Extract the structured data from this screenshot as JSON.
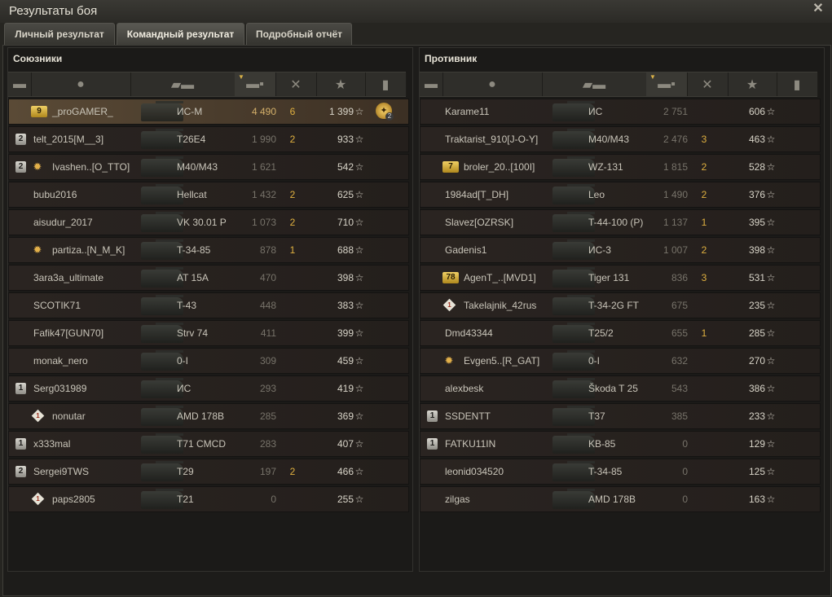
{
  "window": {
    "title": "Результаты боя"
  },
  "tabs": [
    {
      "label": "Личный результат"
    },
    {
      "label": "Командный результат"
    },
    {
      "label": "Подробный отчёт"
    }
  ],
  "star_glyph": "★",
  "allies": {
    "title": "Союзники",
    "rows": [
      {
        "badge": "",
        "mark": {
          "type": "num",
          "text": "9"
        },
        "name": "_proGAMER_",
        "tank": "ИС-М",
        "damage": "4 490",
        "kills": "6",
        "xp": "1 399",
        "player": true,
        "medal": "2"
      },
      {
        "badge": "2",
        "mark": null,
        "name": "telt_2015[M__3]",
        "tank": "T26E4",
        "damage": "1 990",
        "kills": "2",
        "xp": "933"
      },
      {
        "badge": "2",
        "mark": {
          "type": "sun",
          "text": ""
        },
        "name": "Ivashen..[O_TTO]",
        "tank": "M40/M43",
        "damage": "1 621",
        "kills": "",
        "xp": "542"
      },
      {
        "badge": "",
        "mark": null,
        "name": "bubu2016",
        "tank": "Hellcat",
        "damage": "1 432",
        "kills": "2",
        "xp": "625"
      },
      {
        "badge": "",
        "mark": null,
        "name": "aisudur_2017",
        "tank": "VK 30.01 P",
        "damage": "1 073",
        "kills": "2",
        "xp": "710"
      },
      {
        "badge": "",
        "mark": {
          "type": "sun",
          "text": ""
        },
        "name": "partiza..[N_M_K]",
        "tank": "T-34-85",
        "damage": "878",
        "kills": "1",
        "xp": "688"
      },
      {
        "badge": "",
        "mark": null,
        "name": "3ara3a_ultimate",
        "tank": "AT 15A",
        "damage": "470",
        "kills": "",
        "xp": "398"
      },
      {
        "badge": "",
        "mark": null,
        "name": "SCOTIK71",
        "tank": "T-43",
        "damage": "448",
        "kills": "",
        "xp": "383"
      },
      {
        "badge": "",
        "mark": null,
        "name": "Fafik47[GUN70]",
        "tank": "Strv 74",
        "damage": "411",
        "kills": "",
        "xp": "399"
      },
      {
        "badge": "",
        "mark": null,
        "name": "monak_nero",
        "tank": "0-I",
        "damage": "309",
        "kills": "",
        "xp": "459"
      },
      {
        "badge": "1",
        "mark": null,
        "name": "Serg031989",
        "tank": "ИС",
        "damage": "293",
        "kills": "",
        "xp": "419"
      },
      {
        "badge": "",
        "mark": {
          "type": "diamond",
          "text": "1"
        },
        "name": "nonutar",
        "tank": "AMD 178B",
        "damage": "285",
        "kills": "",
        "xp": "369"
      },
      {
        "badge": "1",
        "mark": null,
        "name": "x333mal",
        "tank": "T71 CMCD",
        "damage": "283",
        "kills": "",
        "xp": "407"
      },
      {
        "badge": "2",
        "mark": null,
        "name": "Sergei9TWS",
        "tank": "T29",
        "damage": "197",
        "kills": "2",
        "xp": "466"
      },
      {
        "badge": "",
        "mark": {
          "type": "diamond",
          "text": "1"
        },
        "name": "paps2805",
        "tank": "T21",
        "damage": "0",
        "kills": "",
        "xp": "255"
      }
    ]
  },
  "enemies": {
    "title": "Противник",
    "rows": [
      {
        "badge": "",
        "mark": null,
        "name": "Karame11",
        "tank": "ИС",
        "damage": "2 751",
        "kills": "",
        "xp": "606"
      },
      {
        "badge": "",
        "mark": null,
        "name": "Traktarist_910[J-O-Y]",
        "tank": "M40/M43",
        "damage": "2 476",
        "kills": "3",
        "xp": "463"
      },
      {
        "badge": "",
        "mark": {
          "type": "num",
          "text": "7"
        },
        "name": "broler_20..[100I]",
        "tank": "WZ-131",
        "damage": "1 815",
        "kills": "2",
        "xp": "528"
      },
      {
        "badge": "",
        "mark": null,
        "name": "1984ad[T_DH]",
        "tank": "Leo",
        "damage": "1 490",
        "kills": "2",
        "xp": "376"
      },
      {
        "badge": "",
        "mark": null,
        "name": "Slavez[OZRSK]",
        "tank": "T-44-100 (P)",
        "damage": "1 137",
        "kills": "1",
        "xp": "395"
      },
      {
        "badge": "",
        "mark": null,
        "name": "Gadenis1",
        "tank": "ИС-3",
        "damage": "1 007",
        "kills": "2",
        "xp": "398"
      },
      {
        "badge": "",
        "mark": {
          "type": "num",
          "text": "78"
        },
        "name": "AgenT_..[MVD1]",
        "tank": "Tiger 131",
        "damage": "836",
        "kills": "3",
        "xp": "531"
      },
      {
        "badge": "",
        "mark": {
          "type": "diamond",
          "text": "1"
        },
        "name": "Takelajnik_42rus",
        "tank": "T-34-2G FT",
        "damage": "675",
        "kills": "",
        "xp": "235"
      },
      {
        "badge": "",
        "mark": null,
        "name": "Dmd43344",
        "tank": "T25/2",
        "damage": "655",
        "kills": "1",
        "xp": "285"
      },
      {
        "badge": "",
        "mark": {
          "type": "sun",
          "text": ""
        },
        "name": "Evgen5..[R_GAT]",
        "tank": "0-I",
        "damage": "632",
        "kills": "",
        "xp": "270"
      },
      {
        "badge": "",
        "mark": null,
        "name": "alexbesk",
        "tank": "Škoda T 25",
        "damage": "543",
        "kills": "",
        "xp": "386"
      },
      {
        "badge": "1",
        "mark": null,
        "name": "SSDENTT",
        "tank": "T37",
        "damage": "385",
        "kills": "",
        "xp": "233"
      },
      {
        "badge": "1",
        "mark": null,
        "name": "FATKU11IN",
        "tank": "KB-85",
        "damage": "0",
        "kills": "",
        "xp": "129"
      },
      {
        "badge": "",
        "mark": null,
        "name": "leonid034520",
        "tank": "T-34-85",
        "damage": "0",
        "kills": "",
        "xp": "125"
      },
      {
        "badge": "",
        "mark": null,
        "name": "zilgas",
        "tank": "AMD 178B",
        "damage": "0",
        "kills": "",
        "xp": "163"
      }
    ]
  },
  "column_icons": [
    "squad-icon",
    "player-icon",
    "tank-icon",
    "damage-icon",
    "kills-icon",
    "xp-icon",
    "medal-icon"
  ],
  "colors": {
    "accent": "#e0b040",
    "player_row": "#5a4a36"
  }
}
